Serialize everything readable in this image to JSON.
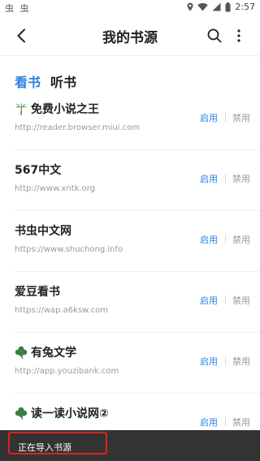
{
  "status_bar": {
    "left_icons": "虫 虫",
    "time": "2:57"
  },
  "header": {
    "title": "我的书源",
    "back_icon": "chevron-left-icon",
    "search_icon": "search-icon",
    "more_icon": "more-vertical-icon"
  },
  "tabs": [
    {
      "label": "看书",
      "active": true
    },
    {
      "label": "听书",
      "active": false
    }
  ],
  "sources": [
    {
      "name": "免费小说之王",
      "icon": "palm-tree-icon",
      "url": "http://reader.browser.miui.com",
      "enable_label": "启用",
      "disable_label": "禁用"
    },
    {
      "name": "567中文",
      "icon": "",
      "url": "http://www.xntk.org",
      "enable_label": "启用",
      "disable_label": "禁用"
    },
    {
      "name": "书虫中文网",
      "icon": "",
      "url": "https://www.shuchong.info",
      "enable_label": "启用",
      "disable_label": "禁用"
    },
    {
      "name": "爱豆看书",
      "icon": "",
      "url": "https://wap.a6ksw.com",
      "enable_label": "启用",
      "disable_label": "禁用"
    },
    {
      "name": "有兔文学",
      "icon": "clover-icon",
      "url": "http://app.youzibank.com",
      "enable_label": "启用",
      "disable_label": "禁用"
    },
    {
      "name": "读一读小说网②",
      "icon": "clover-icon",
      "url": "",
      "enable_label": "启用",
      "disable_label": "禁用"
    }
  ],
  "toast": {
    "text": "正在导入书源"
  },
  "colors": {
    "accent": "#2f80e8",
    "muted": "#9a9a9a",
    "toast_bg": "#333333",
    "highlight": "#e02020"
  }
}
